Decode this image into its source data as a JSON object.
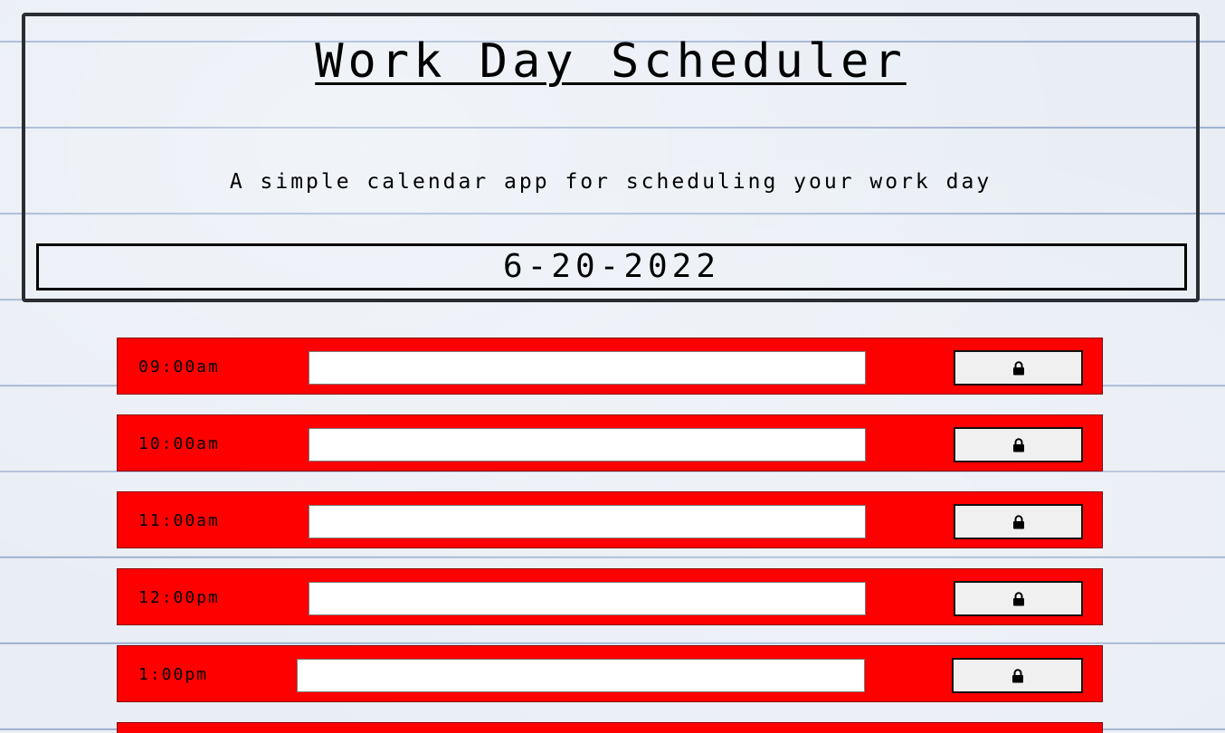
{
  "header": {
    "title": "Work Day Scheduler",
    "subtitle": "A simple calendar app for scheduling your work day",
    "current_date": "6-20-2022"
  },
  "time_blocks": [
    {
      "hour": "09:00am",
      "task": "",
      "status": "past"
    },
    {
      "hour": "10:00am",
      "task": "",
      "status": "past"
    },
    {
      "hour": "11:00am",
      "task": "",
      "status": "past"
    },
    {
      "hour": "12:00pm",
      "task": "",
      "status": "past"
    },
    {
      "hour": "1:00pm",
      "task": "",
      "status": "past"
    }
  ],
  "icons": {
    "save": "lock-icon"
  },
  "colors": {
    "past_block": "#ff0000",
    "background": "#e9eef5",
    "ruled_line": "#9fb1d0"
  }
}
